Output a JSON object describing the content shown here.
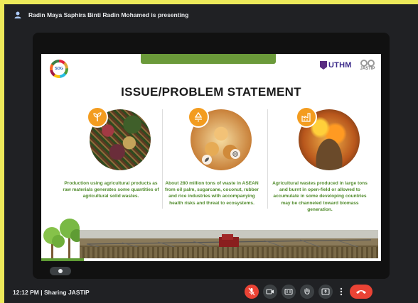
{
  "meeting": {
    "presenter_text": "Radin Maya Saphira Binti Radin Mohamed is presenting",
    "time_sharing": "12:12 PM  |  Sharing JASTIP"
  },
  "slide": {
    "title": "ISSUE/PROBLEM STATEMENT",
    "logos": {
      "sdg": "SDG",
      "uthm": "UTHM",
      "jastip": "JASTIP"
    },
    "columns": [
      {
        "icon": "sprout-icon",
        "text": "Production using agricultural products as raw materials generates some quantities of agricultural solid wastes."
      },
      {
        "icon": "recycle-icon",
        "text": "About 280 million tons of waste in ASEAN from oil palm, sugarcane, coconut, rubber and rice industries with accompanying health risks and threat to ecosystems."
      },
      {
        "icon": "factory-icon",
        "text": "Agricultural wastes produced in large tons and burnt in open-field or allowed to accumulate in some developing countries may be channeled toward biomass generation."
      }
    ]
  },
  "colors": {
    "accent_orange": "#f39c1f",
    "text_green": "#4f8a2a",
    "mic_off_red": "#ea4335",
    "meet_dark": "#202124"
  },
  "controls": [
    {
      "name": "mic-off-button",
      "icon": "mic-off-icon"
    },
    {
      "name": "camera-button",
      "icon": "camera-icon"
    },
    {
      "name": "captions-button",
      "icon": "captions-icon"
    },
    {
      "name": "raise-hand-button",
      "icon": "hand-icon"
    },
    {
      "name": "present-button",
      "icon": "present-icon"
    },
    {
      "name": "more-options-button",
      "icon": "more-vert-icon"
    },
    {
      "name": "leave-call-button",
      "icon": "phone-hangup-icon"
    }
  ]
}
